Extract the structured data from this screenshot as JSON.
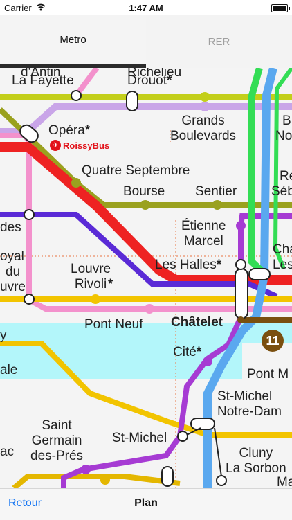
{
  "status_bar": {
    "carrier": "Carrier",
    "time": "1:47 AM"
  },
  "tabs": [
    {
      "label": "Metro",
      "selected": true
    },
    {
      "label": "RER",
      "selected": false
    }
  ],
  "map": {
    "stations": {
      "la_fayette": "La Fayette",
      "drouot": "Drouot",
      "opera": "Opéra",
      "roissybus": "RoissyBus",
      "grands_boulevards": "Grands\nBoulevards",
      "quatre_septembre": "Quatre Septembre",
      "bourse": "Bourse",
      "sentier": "Sentier",
      "etienne_marcel": "Étienne\nMarcel",
      "les_halles": "Les Halles",
      "louvre_rivoli": "Louvre\nRivoli",
      "pont_neuf": "Pont Neuf",
      "chatelet": "Châtelet",
      "cite": "Cité",
      "saint_germain": "Saint\nGermain\ndes-Prés",
      "st_michel": "St-Michel",
      "st_michel_nd": "St-Michel\nNotre-Dam",
      "cluny": "Cluny\nLa Sorbon",
      "pont_m": "Pont M"
    },
    "partial_labels": {
      "antin": "d'Antin",
      "richelieu": "Richelieu",
      "des": "des",
      "oyal": "oyal",
      "du": "du",
      "uvre": "uvre",
      "y": "y",
      "ale": "ale",
      "ac": "ac",
      "b_top": "B",
      "no": "No",
      "re": "Re",
      "seb": "Séb",
      "cha": "Cha",
      "les_right": "Les",
      "ma": "Ma"
    },
    "line_badge": "11",
    "star": "*",
    "colors": {
      "line1": "#f2c400",
      "line3": "#9aa11f",
      "line4": "#a63bd3",
      "line7": "#f391cc",
      "line8": "#c9a5e8",
      "line9": "#c3cf1a",
      "line11": "#7a4f0f",
      "line14": "#5a2ad6",
      "lineB": "#5aa8ef",
      "lineA": "#ee2222",
      "seine": "#b3f6fa"
    }
  },
  "toolbar": {
    "back_label": "Retour",
    "title": "Plan"
  }
}
